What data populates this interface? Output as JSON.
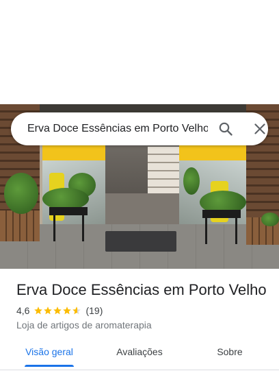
{
  "search": {
    "query": "Erva Doce Essências em Porto Velho",
    "search_icon": "search-icon",
    "close_icon": "close-icon"
  },
  "place": {
    "title": "Erva Doce Essências em Porto Velho",
    "rating": "4,6",
    "rating_value": 4.6,
    "review_count": "(19)",
    "category": "Loja de artigos de aromaterapia"
  },
  "tabs": [
    {
      "label": "Visão geral",
      "active": true
    },
    {
      "label": "Avaliações",
      "active": false
    },
    {
      "label": "Sobre",
      "active": false
    }
  ],
  "colors": {
    "accent": "#1a73e8",
    "star": "#fbbc04",
    "text_primary": "#202124",
    "text_secondary": "#70757a"
  }
}
